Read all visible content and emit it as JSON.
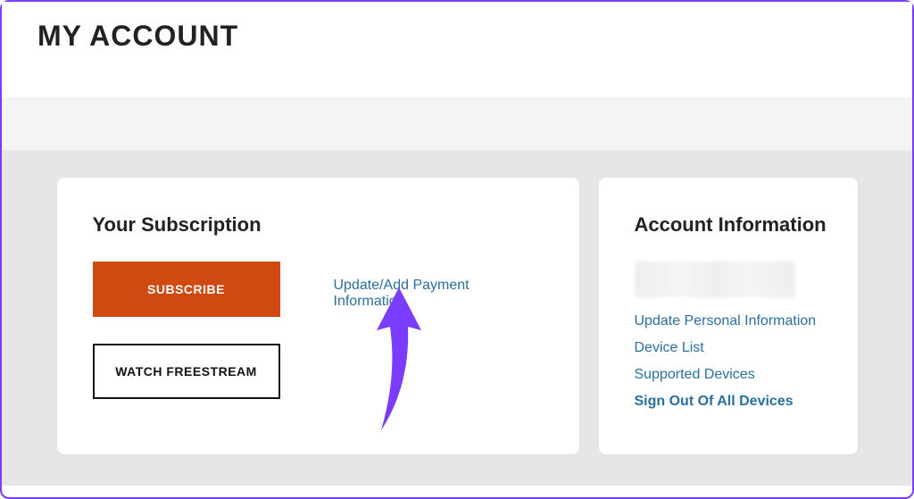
{
  "header": {
    "title": "MY ACCOUNT"
  },
  "subscription": {
    "heading": "Your Subscription",
    "subscribe_label": "SUBSCRIBE",
    "freestream_label": "WATCH FREESTREAM",
    "payment_link": "Update/Add Payment Information"
  },
  "account_info": {
    "heading": "Account Information",
    "links": [
      {
        "label": "Update Personal Information",
        "bold": false
      },
      {
        "label": "Device List",
        "bold": false
      },
      {
        "label": "Supported Devices",
        "bold": false
      },
      {
        "label": "Sign Out Of All Devices",
        "bold": true
      }
    ]
  },
  "annotation": {
    "arrow_color": "#7a3cff"
  }
}
